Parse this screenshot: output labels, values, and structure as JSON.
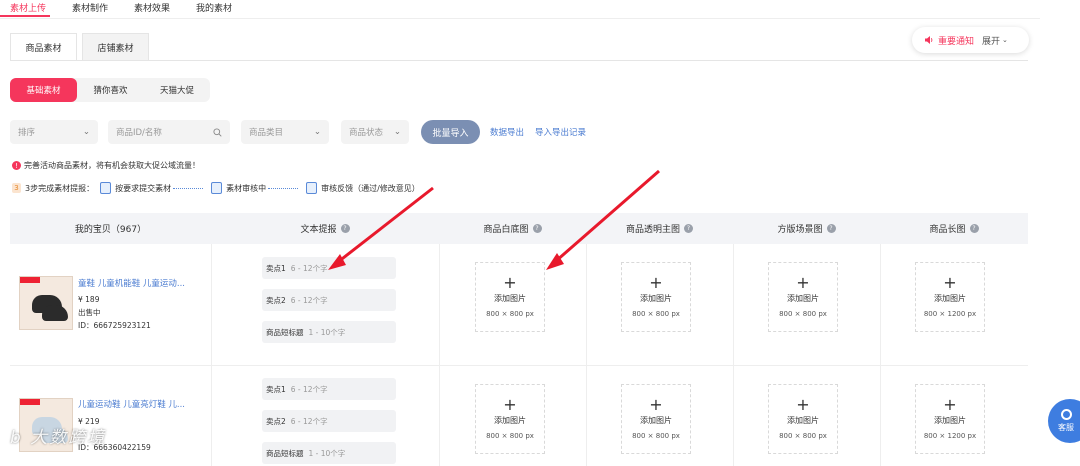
{
  "topnav": [
    "素材上传",
    "素材制作",
    "素材效果",
    "我的素材"
  ],
  "subtabs": [
    "商品素材",
    "店铺素材"
  ],
  "notice": {
    "label": "重要通知",
    "expand": "展开"
  },
  "segments": [
    "基础素材",
    "猜你喜欢",
    "天猫大促"
  ],
  "filters": {
    "sort": "排序",
    "search_placeholder": "商品ID/名称",
    "category": "商品类目",
    "status": "商品状态"
  },
  "batch_import": "批量导入",
  "links": {
    "export": "数据导出",
    "export_log": "导入导出记录"
  },
  "tip": "完善活动商品素材，将有机会获取大促公域流量！",
  "steps": {
    "num": "3",
    "intro": "3步完成素材提报：",
    "s1": "按要求提交素材",
    "s2": "素材审核中",
    "s3": "审核反馈（通过/修改意见）"
  },
  "headers": {
    "c1": "我的宝贝（967）",
    "c2": "文本提报",
    "c3": "商品白底图",
    "c4": "商品透明主图",
    "c5": "方版场景图",
    "c6": "商品长图"
  },
  "rows": [
    {
      "name": "童鞋 儿童机能鞋 儿童运动...",
      "price": "¥ 189",
      "status": "出售中",
      "id": "ID：666725923121"
    },
    {
      "name": "儿童运动鞋 儿童亮灯鞋 儿...",
      "price": "¥ 219",
      "status": "",
      "id": "ID：666360422159"
    }
  ],
  "text_fields": {
    "f1": "卖点1",
    "f1_hint": "6 - 12个字",
    "f2": "卖点2",
    "f2_hint": "6 - 12个字",
    "f3": "商品短标题",
    "f3_hint": "1 - 10个字"
  },
  "upload": {
    "add": "添加图片",
    "size_square": "800 × 800 px",
    "size_long": "800 × 1200 px"
  },
  "service": "客服",
  "watermark": "b 大数跨境",
  "colors": {
    "accent": "#f5365c",
    "link": "#4a7bd0",
    "button": "#7b8fb3",
    "arrow": "#e8192c"
  }
}
